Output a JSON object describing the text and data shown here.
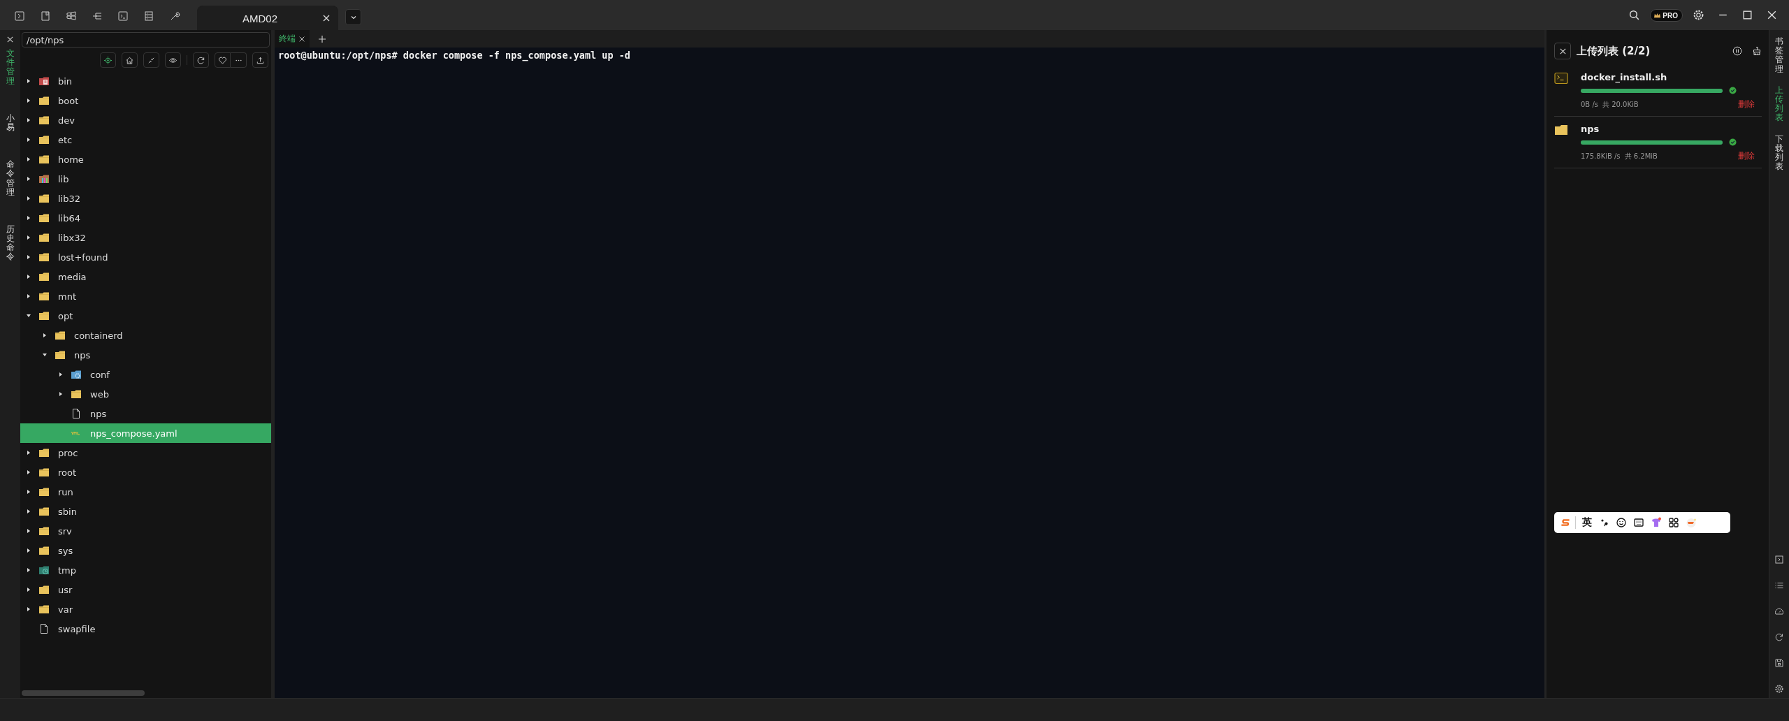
{
  "title_bar": {
    "tabs": [
      {
        "label": "AMD02",
        "selected": true
      }
    ],
    "badge": "PRO"
  },
  "side_nav": [
    {
      "label": "文件管理",
      "selected": true
    },
    {
      "label": "小易",
      "selected": false
    },
    {
      "label": "命令管理",
      "selected": false
    },
    {
      "label": "历史命令",
      "selected": false
    }
  ],
  "file_panel": {
    "path": "/opt/nps",
    "tree": [
      {
        "name": "bin",
        "kind": "bin-folder",
        "expanded": false,
        "selected": false
      },
      {
        "name": "boot",
        "kind": "folder",
        "expanded": false,
        "selected": false
      },
      {
        "name": "dev",
        "kind": "folder",
        "expanded": false,
        "selected": false
      },
      {
        "name": "etc",
        "kind": "folder",
        "expanded": false,
        "selected": false
      },
      {
        "name": "home",
        "kind": "folder",
        "expanded": false,
        "selected": false
      },
      {
        "name": "lib",
        "kind": "lib-folder",
        "expanded": false,
        "selected": false
      },
      {
        "name": "lib32",
        "kind": "folder",
        "expanded": false,
        "selected": false
      },
      {
        "name": "lib64",
        "kind": "folder",
        "expanded": false,
        "selected": false
      },
      {
        "name": "libx32",
        "kind": "folder",
        "expanded": false,
        "selected": false
      },
      {
        "name": "lost+found",
        "kind": "folder",
        "expanded": false,
        "selected": false
      },
      {
        "name": "media",
        "kind": "folder",
        "expanded": false,
        "selected": false
      },
      {
        "name": "mnt",
        "kind": "folder",
        "expanded": false,
        "selected": false
      },
      {
        "name": "opt",
        "kind": "folder",
        "expanded": true,
        "selected": false,
        "children": [
          {
            "name": "containerd",
            "kind": "folder",
            "expanded": false,
            "selected": false
          },
          {
            "name": "nps",
            "kind": "folder",
            "expanded": true,
            "selected": false,
            "children": [
              {
                "name": "conf",
                "kind": "config-folder",
                "expanded": false,
                "selected": false
              },
              {
                "name": "web",
                "kind": "folder",
                "expanded": false,
                "selected": false
              },
              {
                "name": "nps",
                "kind": "file",
                "selected": false
              },
              {
                "name": "nps_compose.yaml",
                "kind": "yaml-file",
                "selected": true
              }
            ]
          }
        ]
      },
      {
        "name": "proc",
        "kind": "folder",
        "expanded": false,
        "selected": false
      },
      {
        "name": "root",
        "kind": "folder",
        "expanded": false,
        "selected": false
      },
      {
        "name": "run",
        "kind": "folder",
        "expanded": false,
        "selected": false
      },
      {
        "name": "sbin",
        "kind": "folder",
        "expanded": false,
        "selected": false
      },
      {
        "name": "srv",
        "kind": "folder",
        "expanded": false,
        "selected": false
      },
      {
        "name": "sys",
        "kind": "folder",
        "expanded": false,
        "selected": false
      },
      {
        "name": "tmp",
        "kind": "temp-folder",
        "expanded": false,
        "selected": false
      },
      {
        "name": "usr",
        "kind": "folder",
        "expanded": false,
        "selected": false
      },
      {
        "name": "var",
        "kind": "folder",
        "expanded": false,
        "selected": false
      },
      {
        "name": "swapfile",
        "kind": "file",
        "selected": false
      }
    ]
  },
  "terminal": {
    "tabs": [
      {
        "label": "終端",
        "selected": true
      }
    ],
    "lines": [
      "root@ubuntu:/opt/nps# docker compose -f nps_compose.yaml up -d"
    ]
  },
  "upload_panel": {
    "title": "上传列表 (2/2)",
    "items": [
      {
        "name": "docker_install.sh",
        "kind": "script",
        "level": 1,
        "done": true,
        "speed": "0B /s",
        "total": "共 20.0KiB",
        "delete_label": "删除"
      },
      {
        "name": "nps",
        "kind": "folder",
        "level": 1,
        "done": true,
        "speed": "175.8KiB /s",
        "total": "共 6.2MiB",
        "delete_label": "删除"
      }
    ]
  },
  "right_nav": [
    {
      "label": "书签管理",
      "selected": false
    },
    {
      "label": "上传列表",
      "selected": true
    },
    {
      "label": "下载列表",
      "selected": false
    }
  ],
  "ime_bar": {
    "mode": "英"
  }
}
